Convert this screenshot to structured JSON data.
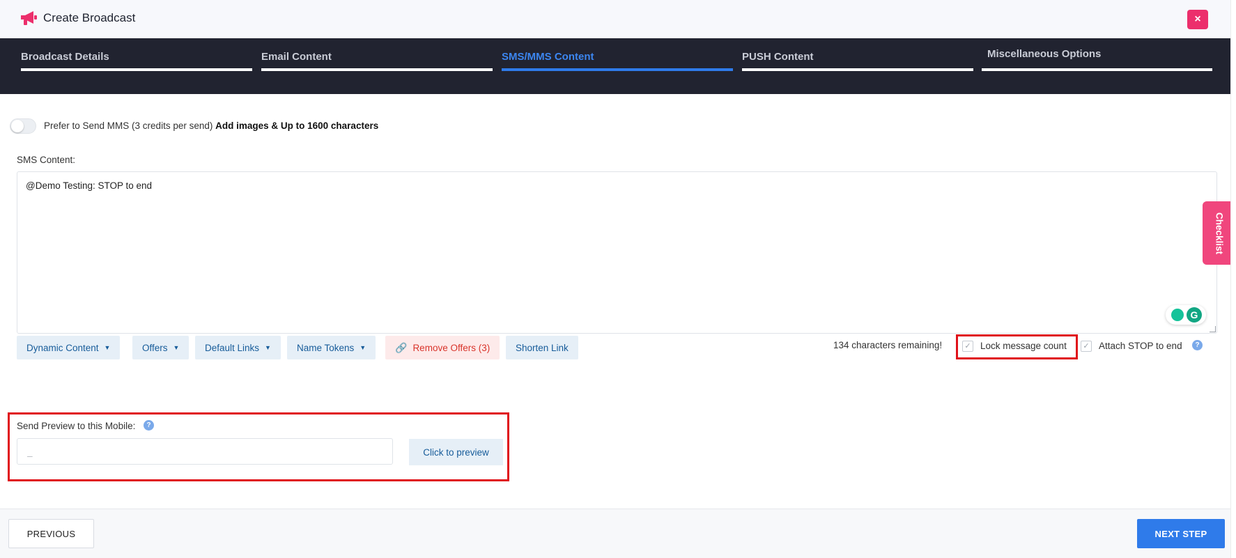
{
  "header": {
    "title": "Create Broadcast",
    "close_label": "×",
    "logo_icon": "megaphone-icon",
    "brand_color": "#ec2f6c"
  },
  "tabs": [
    {
      "label": "Broadcast Details",
      "active": false
    },
    {
      "label": "Email Content",
      "active": false
    },
    {
      "label": "SMS/MMS Content",
      "active": true
    },
    {
      "label": "PUSH Content",
      "active": false
    },
    {
      "label": "Miscellaneous Options",
      "active": false
    }
  ],
  "mms": {
    "text": "Prefer to Send MMS (3 credits per send)",
    "bold_text": "Add images & Up to 1600 characters",
    "enabled": false
  },
  "sms": {
    "label": "SMS Content:",
    "value": "@Demo Testing: STOP to end"
  },
  "toolbar": {
    "dynamic_content": "Dynamic Content",
    "offers": "Offers",
    "default_links": "Default Links",
    "name_tokens": "Name Tokens",
    "remove_offers": "Remove Offers (3)",
    "shorten_link": "Shorten Link"
  },
  "counter": {
    "remaining": "134 characters remaining!",
    "lock_label": "Lock message count",
    "lock_checked": true,
    "stop_label": "Attach STOP to end",
    "stop_checked": true
  },
  "preview": {
    "label": "Send Preview to this Mobile:",
    "placeholder": "_",
    "button": "Click to preview"
  },
  "checklist": {
    "label": "Checklist"
  },
  "footer": {
    "previous": "PREVIOUS",
    "next": "NEXT STEP"
  },
  "colors": {
    "accent": "#2f7bea",
    "dark_band": "#212330",
    "highlight": "#e0121a",
    "checklist": "#f0467d"
  }
}
